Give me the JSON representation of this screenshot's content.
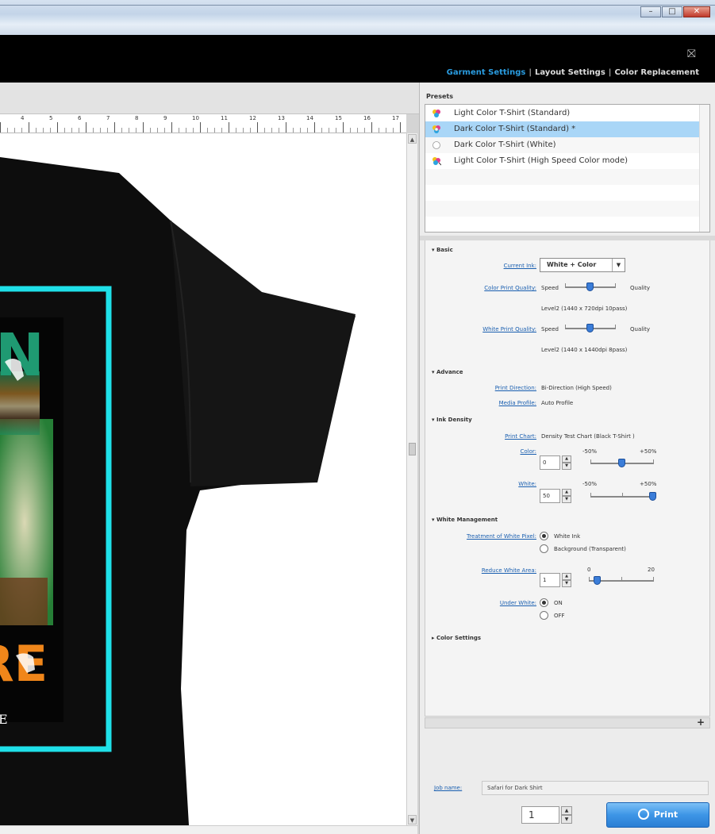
{
  "header": {
    "tabs": [
      "Garment Settings",
      "Layout Settings",
      "Color Replacement"
    ],
    "active_tab": "Garment Settings",
    "separator": "|"
  },
  "ruler": {
    "numbers": [
      "4",
      "5",
      "6",
      "7",
      "8",
      "9",
      "10",
      "11",
      "12",
      "13",
      "14",
      "15",
      "16",
      "17"
    ]
  },
  "artwork": {
    "line1": "N",
    "line2": "RE",
    "line3": "E"
  },
  "presets": {
    "label": "Presets",
    "items": [
      "Light Color T-Shirt (Standard)",
      "Dark Color T-Shirt (Standard) *",
      "Dark Color T-Shirt (White)",
      "Light Color T-Shirt (High Speed Color mode)"
    ],
    "selected_index": 1
  },
  "basic": {
    "section": "Basic",
    "current_ink_label": "Current Ink:",
    "current_ink_value": "White + Color",
    "color_quality_label": "Color Print Quality:",
    "color_quality_left": "Speed",
    "color_quality_right": "Quality",
    "color_quality_level": "Level2 (1440 x 720dpi 10pass)",
    "white_quality_label": "White Print Quality:",
    "white_quality_left": "Speed",
    "white_quality_right": "Quality",
    "white_quality_level": "Level2 (1440 x 1440dpi 8pass)"
  },
  "advance": {
    "section": "Advance",
    "print_direction_label": "Print Direction:",
    "print_direction_value": "Bi-Direction (High Speed)",
    "media_profile_label": "Media Profile:",
    "media_profile_value": "Auto Profile"
  },
  "ink_density": {
    "section": "Ink Density",
    "print_chart_label": "Print Chart:",
    "print_chart_value": "Density Test Chart (Black T-Shirt )",
    "color_label": "Color:",
    "color_value": "0",
    "color_min": "-50%",
    "color_max": "+50%",
    "white_label": "White:",
    "white_value": "50",
    "white_min": "-50%",
    "white_max": "+50%"
  },
  "white_mgmt": {
    "section": "White Management",
    "treatment_label": "Treatment of White Pixel:",
    "treatment_opt1": "White Ink",
    "treatment_opt2": "Background (Transparent)",
    "reduce_label": "Reduce White Area:",
    "reduce_value": "1",
    "reduce_min": "0",
    "reduce_max": "20",
    "under_label": "Under White:",
    "under_opt1": "ON",
    "under_opt2": "OFF"
  },
  "color_settings": {
    "section": "Color Settings"
  },
  "job": {
    "label": "Job name:",
    "value": "Safari for Dark Shirt"
  },
  "print": {
    "copies": "1",
    "button": "Print"
  },
  "colors": {
    "accent": "#2a9ce0",
    "cyan_frame": "#1fe0e8",
    "header_bg": "#000000"
  }
}
